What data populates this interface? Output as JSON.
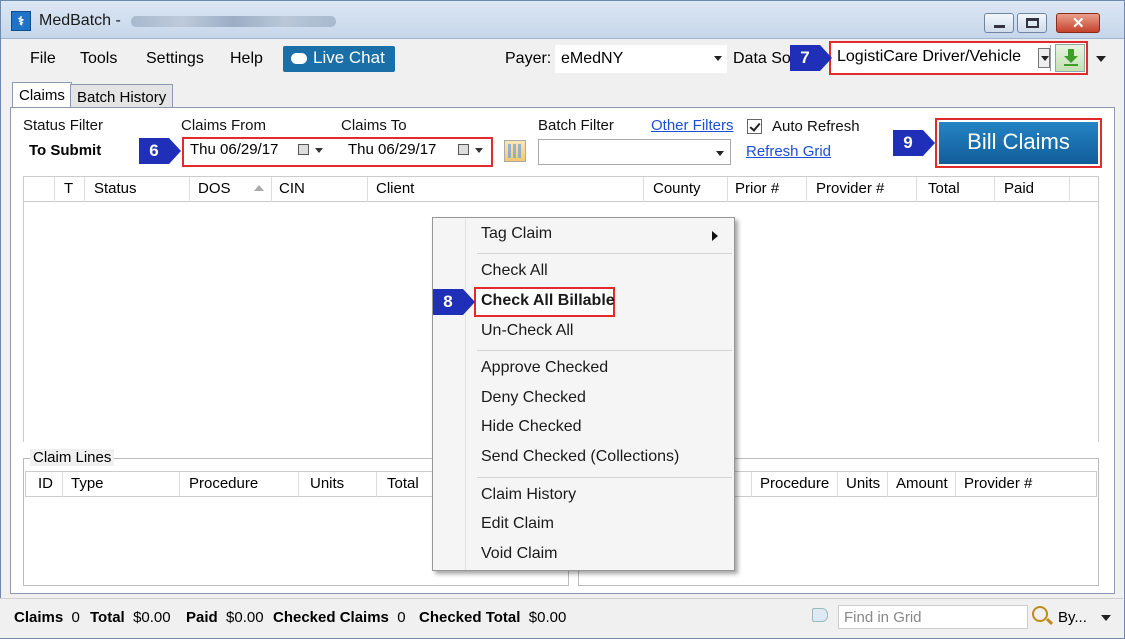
{
  "window": {
    "title": "MedBatch -",
    "title_redacted": true
  },
  "menu": {
    "file": "File",
    "tools": "Tools",
    "settings": "Settings",
    "help": "Help",
    "live_chat": "Live Chat"
  },
  "payer": {
    "label": "Payer:",
    "value": "eMedNY"
  },
  "data_source": {
    "label": "Data Source",
    "value": "LogistiCare Driver/Vehicle"
  },
  "tabs": {
    "claims": "Claims",
    "batch_history": "Batch History"
  },
  "filters": {
    "status_label": "Status Filter",
    "status_value": "To Submit",
    "claims_from_label": "Claims From",
    "claims_from_value": "Thu  06/29/17",
    "claims_to_label": "Claims To",
    "claims_to_value": "Thu  06/29/17",
    "batch_label": "Batch Filter",
    "other_filters": "Other Filters",
    "auto_refresh": "Auto Refresh",
    "refresh_grid": "Refresh Grid"
  },
  "bill_button": "Bill Claims",
  "grid_columns": {
    "t": "T",
    "status": "Status",
    "dos": "DOS",
    "cin": "CIN",
    "client": "Client",
    "county": "County",
    "prior": "Prior #",
    "provider": "Provider #",
    "total": "Total",
    "paid": "Paid"
  },
  "claim_lines": {
    "title": "Claim Lines",
    "id": "ID",
    "type": "Type",
    "procedure": "Procedure",
    "units": "Units",
    "total": "Total",
    "procedure2": "Procedure",
    "units2": "Units",
    "amount": "Amount",
    "provider": "Provider #"
  },
  "context_menu": {
    "tag_claim": "Tag Claim",
    "check_all": "Check All",
    "check_all_billable": "Check All Billable",
    "uncheck_all": "Un-Check All",
    "approve_checked": "Approve Checked",
    "deny_checked": "Deny Checked",
    "hide_checked": "Hide Checked",
    "send_checked": "Send Checked (Collections)",
    "claim_history": "Claim History",
    "edit_claim": "Edit Claim",
    "void_claim": "Void Claim"
  },
  "status_bar": {
    "claims_label": "Claims",
    "claims_value": "0",
    "total_label": "Total",
    "total_value": "$0.00",
    "paid_label": "Paid",
    "paid_value": "$0.00",
    "checked_label": "Checked Claims",
    "checked_value": "0",
    "checked_total_label": "Checked Total",
    "checked_total_value": "$0.00",
    "find_placeholder": "Find in Grid",
    "by": "By..."
  },
  "callouts": {
    "c6": "6",
    "c7": "7",
    "c8": "8",
    "c9": "9"
  },
  "colors": {
    "highlight": "#e32b2b",
    "callout": "#1f2fb8",
    "bill_button": "#1b6fb0"
  }
}
